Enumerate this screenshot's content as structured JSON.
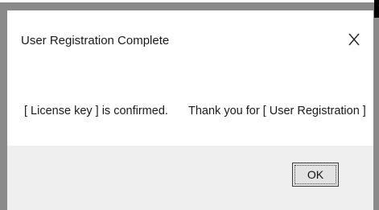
{
  "dialog": {
    "title": "User Registration  Complete",
    "close_glyph": "X",
    "message_left": "[ License key ] is confirmed.",
    "message_right": "Thank you for [ User Registration ]",
    "ok_label": "OK"
  },
  "icons": {
    "close": "close-x-icon"
  },
  "colors": {
    "frame": "#8a8a8a",
    "dialog_background": "#ffffff",
    "button_area": "#efefef",
    "button_face": "#e3e3e3"
  }
}
